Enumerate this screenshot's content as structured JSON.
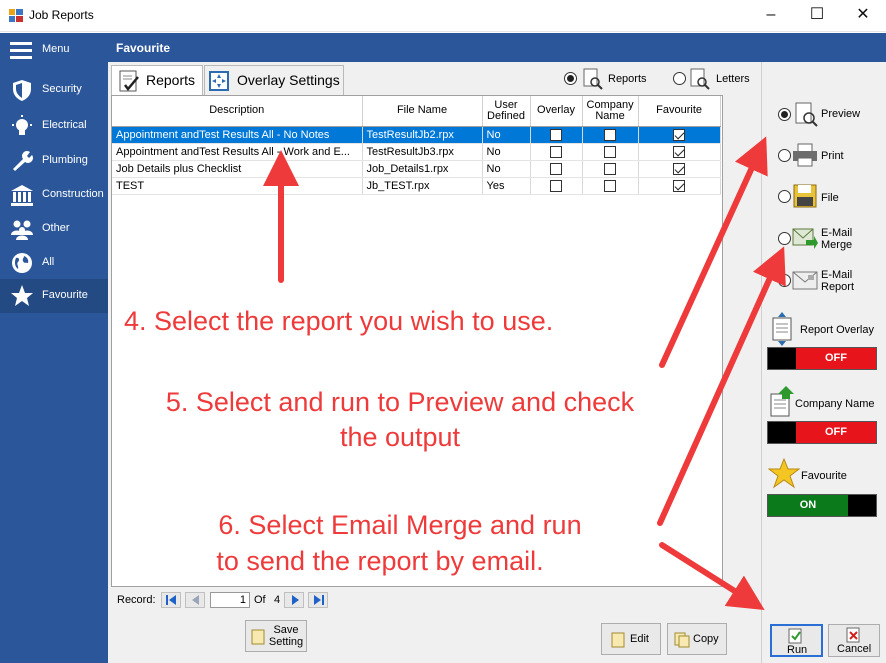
{
  "window": {
    "title": "Job Reports",
    "minimize": "–",
    "maximize": "☐",
    "close": "✕"
  },
  "sidebar": {
    "items": [
      {
        "label": "Menu",
        "icon": "hamburger-icon"
      },
      {
        "label": "Security",
        "icon": "shield-icon"
      },
      {
        "label": "Electrical",
        "icon": "lightbulb-icon"
      },
      {
        "label": "Plumbing",
        "icon": "wrench-icon"
      },
      {
        "label": "Construction",
        "icon": "building-icon"
      },
      {
        "label": "Other",
        "icon": "people-icon"
      },
      {
        "label": "All",
        "icon": "globe-icon"
      },
      {
        "label": "Favourite",
        "icon": "star-icon"
      }
    ]
  },
  "header": {
    "title": "Favourite"
  },
  "tabs": [
    {
      "label": "Reports",
      "active": true
    },
    {
      "label": "Overlay Settings",
      "active": false
    }
  ],
  "filter": {
    "reports_label": "Reports",
    "letters_label": "Letters",
    "selected": "Reports"
  },
  "grid": {
    "columns": [
      "Description",
      "File Name",
      "User Defined",
      "Overlay",
      "Company Name",
      "Favourite"
    ],
    "rows": [
      {
        "description": "Appointment andTest Results All - No Notes",
        "file": "TestResultJb2.rpx",
        "user_defined": "No",
        "overlay": false,
        "company": false,
        "favourite": true,
        "selected": true
      },
      {
        "description": "Appointment andTest Results All - Work and E...",
        "file": "TestResultJb3.rpx",
        "user_defined": "No",
        "overlay": false,
        "company": false,
        "favourite": true,
        "selected": false
      },
      {
        "description": "Job Details plus Checklist",
        "file": "Job_Details1.rpx",
        "user_defined": "No",
        "overlay": false,
        "company": false,
        "favourite": true,
        "selected": false
      },
      {
        "description": "TEST",
        "file": "Jb_TEST.rpx",
        "user_defined": "Yes",
        "overlay": false,
        "company": false,
        "favourite": true,
        "selected": false
      }
    ]
  },
  "navigator": {
    "record_label": "Record:",
    "current": "1",
    "of_label": "Of",
    "total": "4"
  },
  "footer": {
    "save_setting": "Save Setting",
    "edit": "Edit",
    "copy": "Copy"
  },
  "output": {
    "options": [
      {
        "label": "Preview",
        "selected": true
      },
      {
        "label": "Print",
        "selected": false
      },
      {
        "label": "File",
        "selected": false
      },
      {
        "label": "E-Mail Merge",
        "selected": false
      },
      {
        "label": "E-Mail Report",
        "selected": false
      }
    ],
    "report_overlay": {
      "label": "Report Overlay",
      "state": "OFF"
    },
    "company_name": {
      "label": "Company Name",
      "state": "OFF"
    },
    "favourite": {
      "label": "Favourite",
      "state": "ON"
    },
    "run": "Run",
    "cancel": "Cancel"
  },
  "annotations": {
    "step4": "4. Select the report you wish to use.",
    "step5_line1": "5. Select and run to Preview and check",
    "step5_line2": "the output",
    "step6_line1": "6. Select Email Merge and run",
    "step6_line2": "to send the report by email."
  },
  "colors": {
    "sidebar": "#2b579a",
    "selection": "#0078d7",
    "off": "#e8141c",
    "on": "#0a7a1a",
    "annotation": "#ee3a3a"
  }
}
